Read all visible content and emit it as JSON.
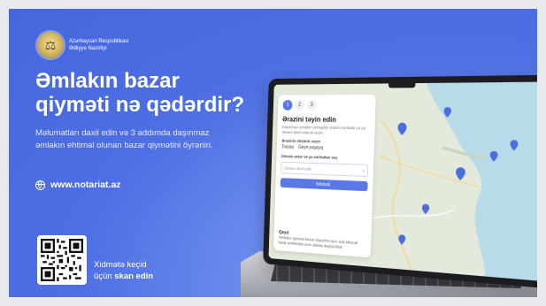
{
  "ministry": {
    "line1": "Azərbaycan Respublikası",
    "line2": "Ədliyyə Nazirliyi"
  },
  "headline": {
    "line1": "Əmlakın bazar",
    "line2": "qiyməti nə qədərdir?"
  },
  "description": "Məlumatları daxil edin və 3 addımda daşınmaz əmlakın ehtimal olunan bazar qiymətini öyrənin.",
  "website": "www.notariat.az",
  "scan": {
    "line1": "Xidmətə keçid",
    "line2_prefix": "üçün ",
    "line2_bold": "skan edin"
  },
  "app_panel": {
    "steps": [
      "1",
      "2",
      "3"
    ],
    "title": "Ərazini təyin edin",
    "description": "Daşınmaz əmlakın yerləşdiyi ərazini xəritədə və ya ünvanı daxil edərək seçin",
    "option_label": "Ərazinin növünü seçin",
    "options": [
      "Torpaq",
      "Geyri-yaşayış"
    ],
    "address_hint": "Ünvanı axtar və ya xəritədən seç",
    "address_placeholder": "Ünvanı daxil edin",
    "button": "Növbəti",
    "note_title": "Qeyd",
    "note_text": "Əmlakın qiyməti bazar dəyərinə təsir edə biləcək fərqli amillərdən asılı olaraq dəyişə bilər"
  },
  "colors": {
    "background": "#4766dc",
    "accent": "#5a78e6",
    "map_land": "#e4eadb",
    "map_water": "#b7dbe9",
    "pin": "#4a6de0"
  }
}
